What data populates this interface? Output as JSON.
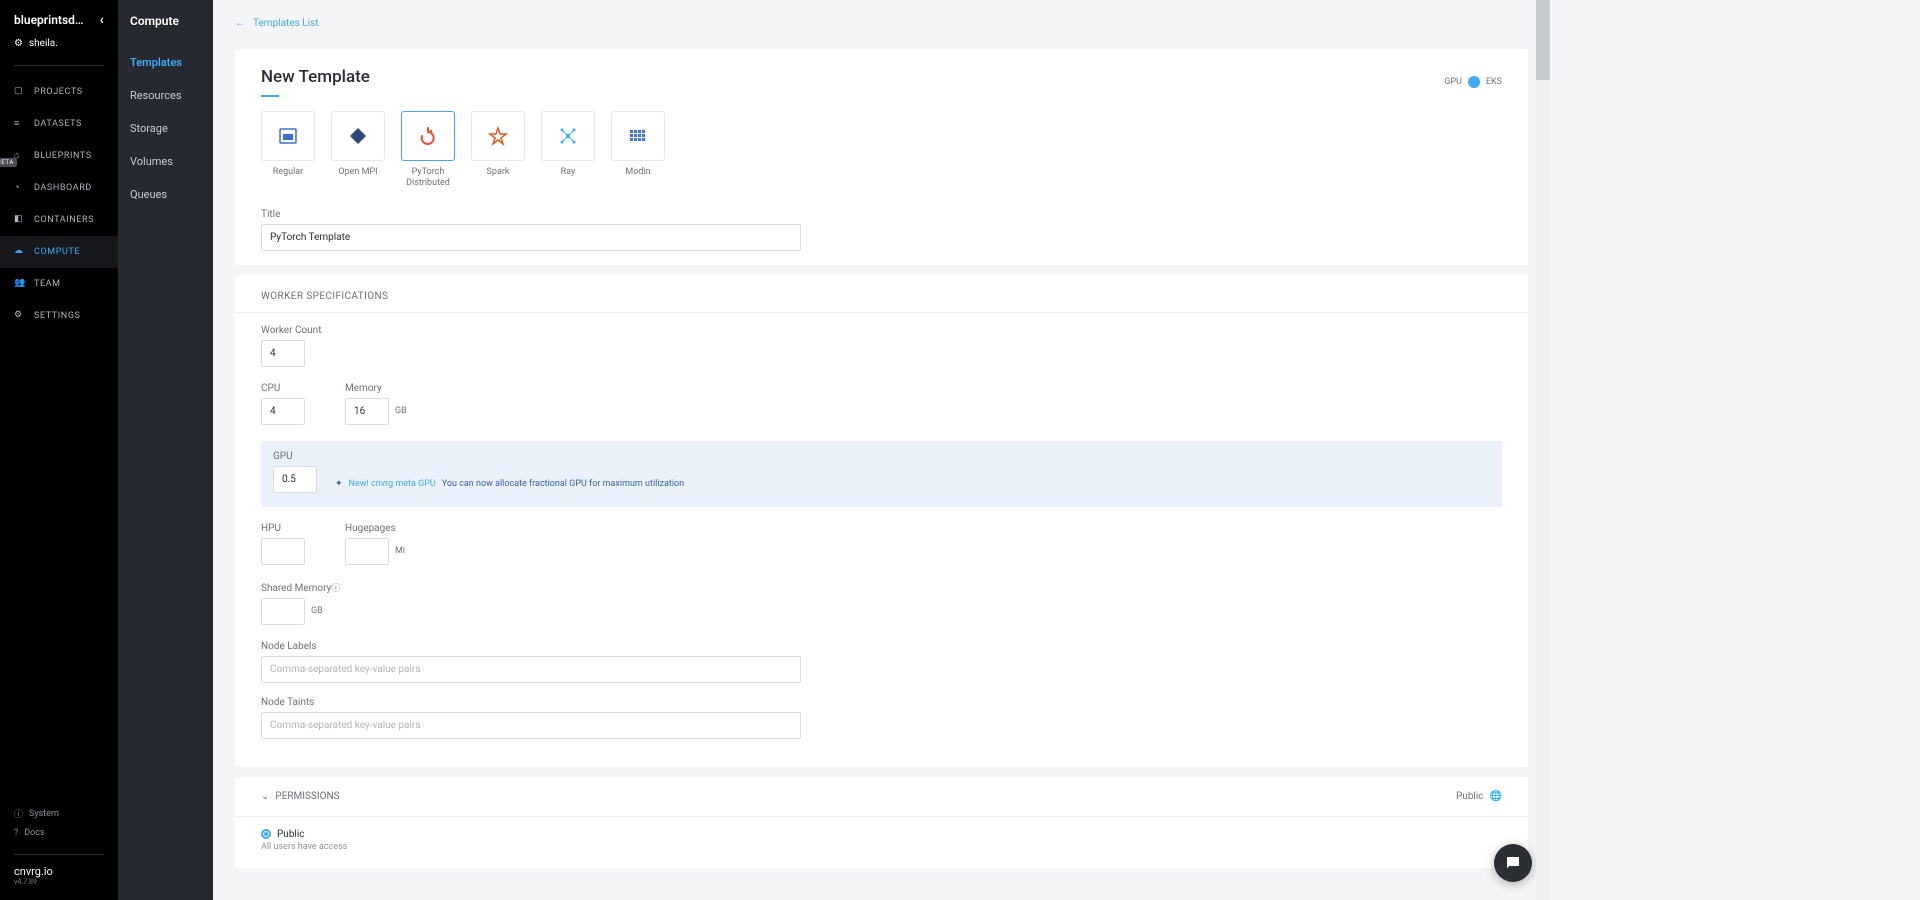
{
  "workspace": {
    "name": "blueprintsd…"
  },
  "user": {
    "name": "sheila."
  },
  "nav1": {
    "items": [
      {
        "label": "PROJECTS"
      },
      {
        "label": "DATASETS"
      },
      {
        "label": "BLUEPRINTS"
      },
      {
        "label": "DASHBOARD"
      },
      {
        "label": "CONTAINERS"
      },
      {
        "label": "COMPUTE"
      },
      {
        "label": "TEAM"
      },
      {
        "label": "SETTINGS"
      }
    ],
    "bottom": {
      "system": "System",
      "docs": "Docs"
    },
    "brand": "cnvrg.io",
    "version": "v4.7.89"
  },
  "nav2": {
    "title": "Compute",
    "items": [
      {
        "label": "Templates"
      },
      {
        "label": "Resources"
      },
      {
        "label": "Storage"
      },
      {
        "label": "Volumes"
      },
      {
        "label": "Queues"
      }
    ]
  },
  "back_label": "Templates List",
  "page": {
    "title": "New Template",
    "gpu_label": "GPU",
    "cluster": "EKS"
  },
  "tiles": [
    {
      "label": "Regular",
      "color": "#3b6fd6"
    },
    {
      "label": "Open MPI",
      "color": "#2c4a7a"
    },
    {
      "label": "PyTorch Distributed",
      "color": "#ee4c2c"
    },
    {
      "label": "Spark",
      "color": "#e25a1c"
    },
    {
      "label": "Ray",
      "color": "#3fa9f5"
    },
    {
      "label": "Modin",
      "color": "#3c74e0"
    }
  ],
  "form": {
    "title_label": "Title",
    "title_value": "PyTorch Template",
    "worker_section": "WORKER SPECIFICATIONS",
    "worker_count_label": "Worker Count",
    "worker_count_value": "4",
    "cpu_label": "CPU",
    "cpu_value": "4",
    "memory_label": "Memory",
    "memory_value": "16",
    "memory_unit": "GB",
    "gpu_label": "GPU",
    "gpu_value": "0.5",
    "gpu_tip_link": "New! cnvrg meta GPU",
    "gpu_tip_text": " You can now allocate fractional GPU for maximum utilization",
    "hpu_label": "HPU",
    "hpu_value": "",
    "huge_label": "Hugepages",
    "huge_value": "",
    "huge_unit": "Mi",
    "shared_label": "Shared Memory",
    "shared_value": "",
    "shared_unit": "GB",
    "labels_label": "Node Labels",
    "labels_placeholder": "Comma-separated key-value pairs",
    "taints_label": "Node Taints",
    "taints_placeholder": "Comma-separated key-value pairs"
  },
  "perm": {
    "section": "PERMISSIONS",
    "right_label": "Public",
    "public_label": "Public",
    "public_desc": "All users have access"
  }
}
